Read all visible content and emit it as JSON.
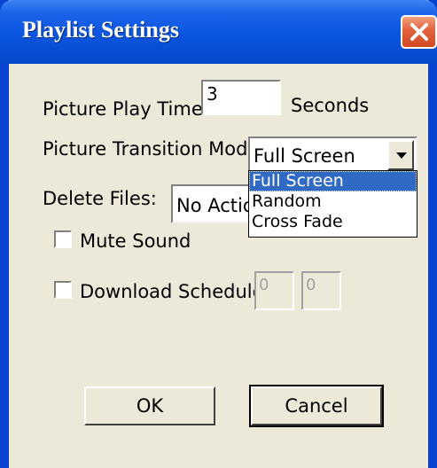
{
  "window": {
    "title": "Playlist Settings"
  },
  "picture_play_time": {
    "label": "Picture Play Time:",
    "value": "3",
    "unit": "Seconds"
  },
  "transition": {
    "label": "Picture Transition Mode:",
    "selected": "Full Screen",
    "options": [
      "Full Screen",
      "Random",
      "Cross Fade"
    ],
    "highlighted_index": 0
  },
  "delete_files": {
    "label": "Delete Files:",
    "value": "No Action"
  },
  "mute_sound": {
    "label": "Mute Sound",
    "checked": false
  },
  "download_schedule": {
    "label": "Download Schedule",
    "checked": false,
    "start": "0",
    "end": "0"
  },
  "buttons": {
    "ok": "OK",
    "cancel": "Cancel"
  },
  "icons": {
    "close": "close-icon",
    "dropdown": "chevron-down-icon"
  },
  "colors": {
    "titlebar": "#0a55df",
    "close": "#e2613b",
    "highlight": "#316ac5",
    "window_bg": "#ece9d8"
  }
}
